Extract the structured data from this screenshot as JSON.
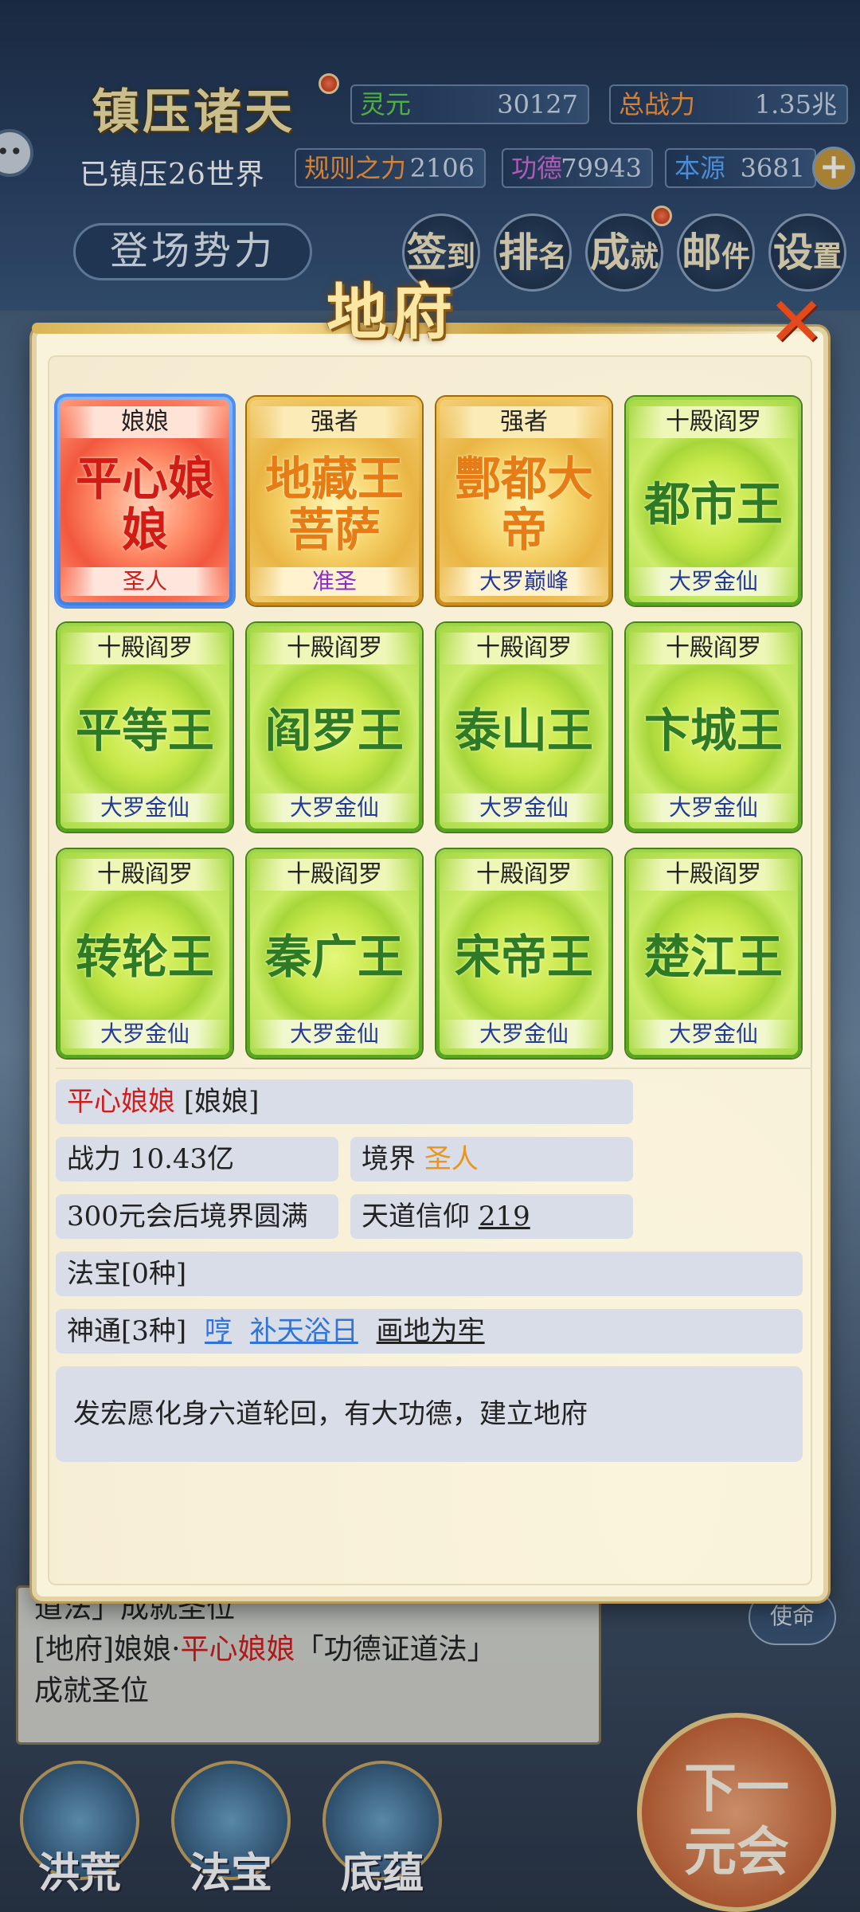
{
  "header": {
    "game_title": "镇压诸天",
    "world_count": "已镇压26世界",
    "faction_button": "登场势力",
    "stats": [
      {
        "label": "灵元",
        "value": "30127"
      },
      {
        "label": "总战力",
        "value": "1.35兆"
      },
      {
        "label": "规则之力",
        "value": "2106"
      },
      {
        "label": "功德",
        "value": "79943"
      },
      {
        "label": "本源",
        "value": "3681"
      }
    ],
    "menu": [
      {
        "big": "签",
        "small": "到"
      },
      {
        "big": "排",
        "small": "名"
      },
      {
        "big": "成",
        "small": "就"
      },
      {
        "big": "邮",
        "small": "件"
      },
      {
        "big": "设",
        "small": "置"
      }
    ]
  },
  "modal": {
    "title": "地府",
    "close_glyph": "✕",
    "cards": [
      {
        "category": "娘娘",
        "name": "平心娘娘",
        "rank": "圣人",
        "style": "red",
        "rank_color": "#d11c1c"
      },
      {
        "category": "强者",
        "name": "地藏王菩萨",
        "rank": "准圣",
        "style": "gold",
        "rank_color": "#8a2bd1"
      },
      {
        "category": "强者",
        "name": "酆都大帝",
        "rank": "大罗巅峰",
        "style": "gold",
        "rank_color": "#233a9a"
      },
      {
        "category": "十殿阎罗",
        "name": "都市王",
        "rank": "大罗金仙",
        "style": "green",
        "rank_color": "#233a9a"
      },
      {
        "category": "十殿阎罗",
        "name": "平等王",
        "rank": "大罗金仙",
        "style": "green",
        "rank_color": "#233a9a"
      },
      {
        "category": "十殿阎罗",
        "name": "阎罗王",
        "rank": "大罗金仙",
        "style": "green",
        "rank_color": "#233a9a"
      },
      {
        "category": "十殿阎罗",
        "name": "泰山王",
        "rank": "大罗金仙",
        "style": "green",
        "rank_color": "#233a9a"
      },
      {
        "category": "十殿阎罗",
        "name": "卞城王",
        "rank": "大罗金仙",
        "style": "green",
        "rank_color": "#233a9a"
      },
      {
        "category": "十殿阎罗",
        "name": "转轮王",
        "rank": "大罗金仙",
        "style": "green",
        "rank_color": "#233a9a"
      },
      {
        "category": "十殿阎罗",
        "name": "秦广王",
        "rank": "大罗金仙",
        "style": "green",
        "rank_color": "#233a9a"
      },
      {
        "category": "十殿阎罗",
        "name": "宋帝王",
        "rank": "大罗金仙",
        "style": "green",
        "rank_color": "#233a9a"
      },
      {
        "category": "十殿阎罗",
        "name": "楚江王",
        "rank": "大罗金仙",
        "style": "green",
        "rank_color": "#233a9a"
      }
    ],
    "detail": {
      "name": "平心娘娘",
      "tag": "[娘娘]",
      "power_label": "战力",
      "power_value": "10.43亿",
      "realm_label": "境界",
      "realm_value": "圣人",
      "perfection": "300元会后境界圆满",
      "faith_label": "天道信仰",
      "faith_value": "219",
      "treasure": "法宝[0种]",
      "abilities_label": "神通[3种]",
      "abilities": [
        "哼",
        "补天浴日",
        "画地为牢"
      ],
      "description": "发宏愿化身六道轮回，有大功德，建立地府"
    }
  },
  "log": {
    "line1": "道法」成就圣位",
    "line2_prefix": "[地府]娘娘·",
    "line2_name": "平心娘娘",
    "line2_suffix": "「功德证道法」",
    "line3": "成就圣位"
  },
  "side_tag": "使命",
  "bottom_nav": [
    "洪荒",
    "法宝",
    "底蕴"
  ],
  "next_button": {
    "line1": "下一",
    "line2": "元会"
  }
}
